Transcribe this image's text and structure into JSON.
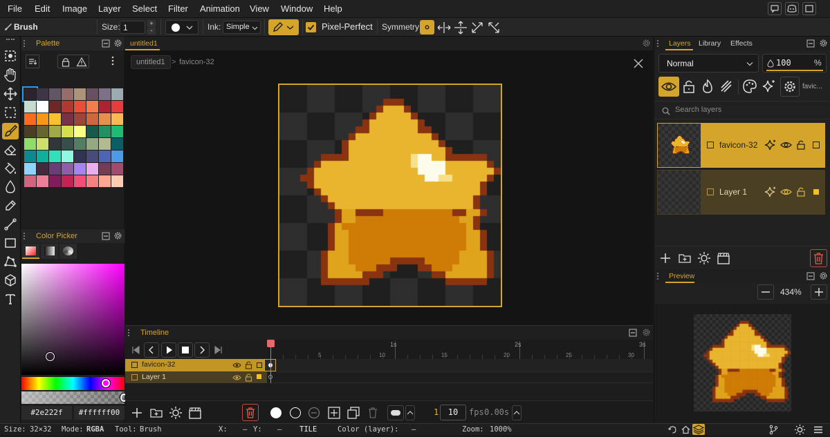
{
  "menu": [
    "File",
    "Edit",
    "Image",
    "Layer",
    "Select",
    "Filter",
    "Animation",
    "View",
    "Window",
    "Help"
  ],
  "toolbar": {
    "tool_name": "Brush",
    "size_label": "Size:",
    "size_value": "1",
    "ink_label": "Ink:",
    "ink_value": "Simple",
    "pixel_perfect_label": "Pixel-Perfect",
    "symmetry_label": "Symmetry:"
  },
  "palette": {
    "tab": "Palette",
    "colors": [
      "#2e222f",
      "#3e3546",
      "#625565",
      "#966c6c",
      "#ab947a",
      "#694f62",
      "#7f708a",
      "#9babb2",
      "#c7dcd0",
      "#ffffff",
      "#6e2727",
      "#b33831",
      "#ea4f36",
      "#f57d4a",
      "#ae2334",
      "#e83b3b",
      "#fb6b1d",
      "#f79617",
      "#f9c22b",
      "#7a3045",
      "#9e4539",
      "#cd683d",
      "#e6904e",
      "#fbb954",
      "#4c3e24",
      "#676633",
      "#a2a947",
      "#d5e04b",
      "#fbff86",
      "#165a4c",
      "#239063",
      "#1ebc73",
      "#91db69",
      "#cddf6c",
      "#313638",
      "#374e4a",
      "#547e64",
      "#92a984",
      "#b2ba90",
      "#0b5e65",
      "#0b8a8f",
      "#0eaf9b",
      "#30e1b9",
      "#8ff8e2",
      "#323353",
      "#484a77",
      "#4d65b4",
      "#4d9be6",
      "#8fd3ff",
      "#45293f",
      "#6b3e75",
      "#905ea9",
      "#a884f3",
      "#eaaded",
      "#753c54",
      "#a24b6f",
      "#cf657f",
      "#ed8099",
      "#831c5d",
      "#c32454",
      "#f04f78",
      "#f68181",
      "#fca790",
      "#fdcbb0"
    ]
  },
  "color_picker": {
    "tab": "Color Picker",
    "hex_primary": "#2e222f",
    "hex_secondary": "#ffffff00"
  },
  "canvas": {
    "doc_tab": "untitled1",
    "breadcrumb_root": "untitled1",
    "breadcrumb_sep": ">",
    "breadcrumb_leaf": "favicon-32"
  },
  "timeline": {
    "tab": "Timeline",
    "ruler_seconds": [
      "1s",
      "2s",
      "3s"
    ],
    "ruler_frames": [
      "5",
      "10",
      "15",
      "20",
      "25",
      "30"
    ],
    "layers": [
      {
        "name": "favicon-32"
      },
      {
        "name": "Layer 1"
      }
    ],
    "current_frame": "1",
    "fps_value": "10",
    "fps_label": "fps",
    "time_value": "0.00s"
  },
  "layers_panel": {
    "tabs": [
      "Layers",
      "Library",
      "Effects"
    ],
    "blend_mode": "Normal",
    "opacity": "100",
    "opacity_unit": "%",
    "filter_label": "favic...",
    "search_placeholder": "Search layers",
    "layers": [
      {
        "name": "favicon-32",
        "selected": true
      },
      {
        "name": "Layer 1",
        "selected": false
      }
    ]
  },
  "preview": {
    "tab": "Preview",
    "zoom": "434%"
  },
  "status": {
    "size_label": "Size:",
    "size_value": "32×32",
    "mode_label": "Mode:",
    "mode_value": "RGBA",
    "tool_label": "Tool:",
    "tool_value": "Brush",
    "x_label": "X:",
    "x_value": "—",
    "y_label": "Y:",
    "y_value": "—",
    "tile_label": "TILE",
    "color_label": "Color (layer):",
    "color_value": "—",
    "zoom_label": "Zoom:",
    "zoom_value": "1000%"
  },
  "sprite": {
    "rows": [
      "................................",
      "................................",
      "...............ooo..............",
      "..............oYYYo.............",
      ".............oYYYYYo............",
      "............oYYYYYYYo...........",
      "...........ooYYYYYYYoo..........",
      "..........oYYYYYYYYYYYo.........",
      ".........oYYYYYYYYYYYYYo........",
      ".........oYYYYYYYYYYYYYYo.......",
      "......ooooYYYYYYYYYHWWYYoooooo..",
      ".....oYYYYYYYYYYYYYHWWWWYYYYYYo.",
      "....oYYYYYYYYYYYYYYYWWWWYYYYYYYo",
      "...ooYYYYYYYYYYYYYYYYWWHHYYYYYo.",
      "....oYYYYYYYYYYYYYYYYYYYYYYYYo..",
      ".....oYYYYYYYYYYYYYYYYYYYYYYYo..",
      "......oYYYYYYYYYYYYYYYYYYYYYo...",
      ".......oYYYYYYYYYYYYYYYYYYYYo....",
      "........oLLooooOOOOOOOOOOooLLo....",
      "........oLLOOOOOOOOOOOOOOOLLo.....",
      ".......oLOOOOOOOOOOOOOOOOOOLo.....",
      ".......oLLOOOOOOOOOOOOOOOOOLLo....",
      ".......oLLOOOOOOOOOOOOOOOOOLLo....",
      ".......oLLOOOOOOOOOOOOOOOOOLLo....",
      "......oLLLOOOOOOOOOOOOOOOOLLLLo...",
      "......oLLLOOOOOOoooooOOOOOLLLLo...",
      "......oLLLLOOOooo...ooOOOLLLLLo...",
      "......oLLLLLooo.......ooLLLLLLo...",
      "......ooooooo...........oooooo....",
      "................................",
      "................................",
      "................................"
    ]
  }
}
